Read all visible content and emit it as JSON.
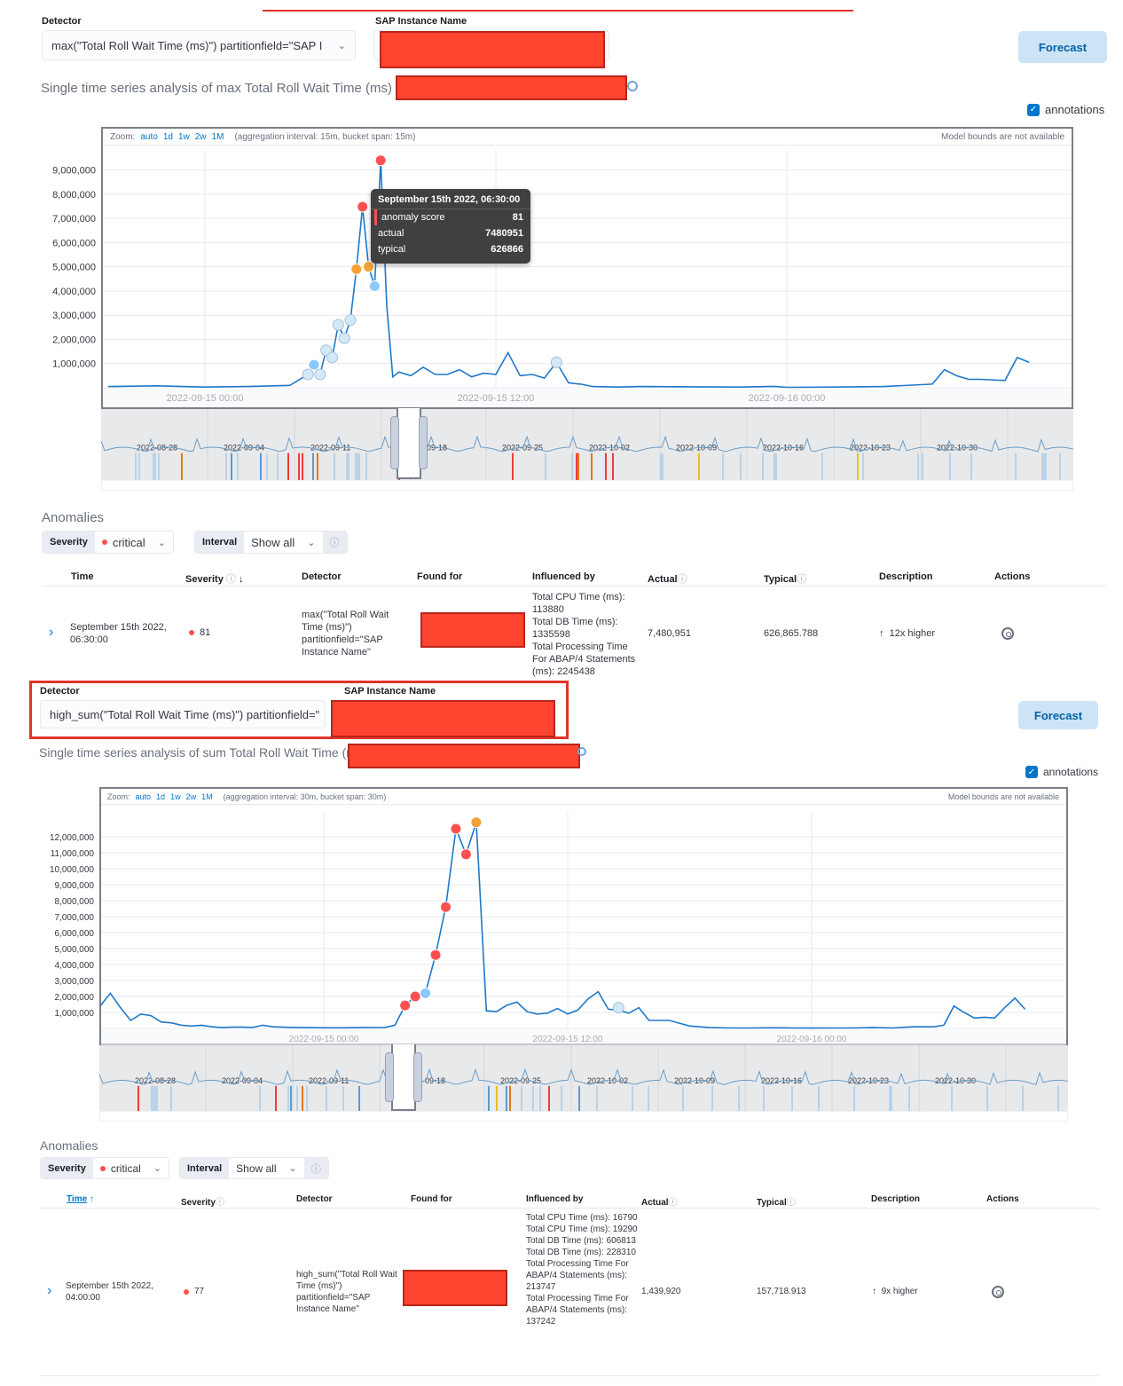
{
  "panel1": {
    "detector_label": "Detector",
    "detector_value": "max(\"Total Roll Wait Time (ms)\") partitionfield=\"SAP I",
    "instance_label": "SAP Instance Name",
    "forecast_label": "Forecast",
    "title": "Single time series analysis of max Total Roll Wait Time (ms)",
    "annotations_label": "annotations",
    "annotations_checked": true,
    "zoom_prefix": "Zoom:",
    "zoom_options": [
      "auto",
      "1d",
      "1w",
      "2w",
      "1M"
    ],
    "aggregation_text": "(aggregation interval: 15m, bucket span: 15m)",
    "model_bounds_text": "Model bounds are not available",
    "tooltip": {
      "title": "September 15th 2022, 06:30:00",
      "rows": [
        {
          "label": "anomaly score",
          "value": "81"
        },
        {
          "label": "actual",
          "value": "7480951"
        },
        {
          "label": "typical",
          "value": "626866"
        }
      ]
    },
    "context_labels": [
      "2022-08-28",
      "2022-09-04",
      "2022-09-11",
      "22-09-18",
      "2022-09-25",
      "2022-10-02",
      "2022-10-09",
      "2022-10-16",
      "2022-10-23",
      "2022-10-30"
    ],
    "anomalies": {
      "heading": "Anomalies",
      "severity_label": "Severity",
      "severity_value": "critical",
      "interval_label": "Interval",
      "interval_value": "Show all",
      "columns": [
        "Time",
        "Severity",
        "Detector",
        "Found for",
        "Influenced by",
        "Actual",
        "Typical",
        "Description",
        "Actions"
      ],
      "row": {
        "time": "September 15th 2022, 06:30:00",
        "severity": "81",
        "detector": "max(\"Total Roll Wait Time (ms)\") partitionfield=\"SAP Instance Name\"",
        "influenced_by": [
          "Total CPU Time (ms): 113880",
          "Total DB Time (ms): 1335598",
          "Total Processing Time For ABAP/4 Statements (ms): 2245438"
        ],
        "actual": "7,480,951",
        "typical": "626,865.788",
        "description": "12x higher"
      }
    }
  },
  "panel2": {
    "detector_label": "Detector",
    "detector_value": "high_sum(\"Total Roll Wait Time (ms)\") partitionfield=\"",
    "instance_label": "SAP Instance Name",
    "forecast_label": "Forecast",
    "title": "Single time series analysis of sum Total Roll Wait Time (m",
    "annotations_label": "annotations",
    "annotations_checked": true,
    "zoom_prefix": "Zoom:",
    "zoom_options": [
      "auto",
      "1d",
      "1w",
      "2w",
      "1M"
    ],
    "aggregation_text": "(aggregation interval: 30m, bucket span: 30m)",
    "model_bounds_text": "Model bounds are not available",
    "context_labels": [
      "2022-08-28",
      "2022-09-04",
      "2022-09-11",
      "22-09-18",
      "2022-09-25",
      "2022-10-02",
      "2022-10-09",
      "2022-10-16",
      "2022-10-23",
      "2022-10-30"
    ],
    "anomalies": {
      "heading": "Anomalies",
      "severity_label": "Severity",
      "severity_value": "critical",
      "interval_label": "Interval",
      "interval_value": "Show all",
      "columns": [
        "Time",
        "Severity",
        "Detector",
        "Found for",
        "Influenced by",
        "Actual",
        "Typical",
        "Description",
        "Actions"
      ],
      "row": {
        "time": "September 15th 2022, 04:00:00",
        "severity": "77",
        "detector": "high_sum(\"Total Roll Wait Time (ms)\") partitionfield=\"SAP Instance Name\"",
        "influenced_by": [
          "Total CPU Time (ms): 16790",
          "Total CPU Time (ms): 19290",
          "Total DB Time (ms): 606813",
          "Total DB Time (ms): 228310",
          "Total Processing Time For ABAP/4 Statements (ms): 213747",
          "Total Processing Time For ABAP/4 Statements (ms): 137242"
        ],
        "actual": "1,439,920",
        "typical": "157,718.913",
        "description": "9x higher"
      }
    }
  },
  "colors": {
    "line": "#1f78c8",
    "critical": "#fe5050",
    "major": "#f5a035",
    "minor": "#8bc8fb",
    "warning": "#d2e9f7",
    "accent": "#0077cc"
  },
  "chart_data": [
    {
      "type": "line",
      "title": "Single time series analysis of max Total Roll Wait Time (ms)",
      "x_ticks": [
        "2022-09-15 00:00",
        "2022-09-15 12:00",
        "2022-09-16 00:00"
      ],
      "y_ticks": [
        "1,000,000",
        "2,000,000",
        "3,000,000",
        "4,000,000",
        "5,000,000",
        "6,000,000",
        "7,000,000",
        "8,000,000",
        "9,000,000"
      ],
      "ylim": [
        0,
        9500000
      ],
      "x_hours": [
        -4,
        -2,
        0,
        2,
        3.5,
        4.25,
        4.5,
        4.75,
        5.0,
        5.25,
        5.5,
        5.75,
        6.0,
        6.25,
        6.5,
        6.75,
        7.0,
        7.25,
        7.5,
        7.75,
        8.0,
        8.5,
        9.0,
        9.5,
        10.0,
        10.5,
        11.0,
        11.5,
        12.0,
        12.5,
        13.0,
        13.5,
        14.0,
        14.5,
        15.0,
        15.5,
        16.0,
        17.0,
        18.0,
        20.0,
        22.0,
        23.5,
        24.0,
        26.0,
        28.0,
        30.0,
        30.5,
        31.0,
        31.5,
        32.0,
        33.0,
        33.5,
        34.0
      ],
      "values": [
        50000,
        80000,
        30000,
        60000,
        100000,
        550000,
        950000,
        550000,
        1550000,
        1250000,
        2600000,
        2050000,
        2800000,
        4900000,
        7480951,
        5000000,
        4200000,
        9400000,
        3400000,
        450000,
        650000,
        500000,
        850000,
        550000,
        550000,
        750000,
        450000,
        600000,
        550000,
        1450000,
        500000,
        550000,
        400000,
        1050000,
        200000,
        150000,
        50000,
        30000,
        50000,
        40000,
        30000,
        60000,
        20000,
        30000,
        50000,
        150000,
        750000,
        500000,
        350000,
        350000,
        300000,
        1250000,
        1050000
      ],
      "markers": [
        {
          "x_hour": 4.25,
          "value": 550000,
          "severity": "warning"
        },
        {
          "x_hour": 4.5,
          "value": 950000,
          "severity": "minor"
        },
        {
          "x_hour": 4.75,
          "value": 550000,
          "severity": "warning"
        },
        {
          "x_hour": 5.0,
          "value": 1550000,
          "severity": "warning"
        },
        {
          "x_hour": 5.25,
          "value": 1250000,
          "severity": "warning"
        },
        {
          "x_hour": 5.75,
          "value": 2050000,
          "severity": "warning"
        },
        {
          "x_hour": 5.5,
          "value": 2600000,
          "severity": "warning"
        },
        {
          "x_hour": 6.0,
          "value": 2800000,
          "severity": "warning"
        },
        {
          "x_hour": 6.25,
          "value": 4900000,
          "severity": "major"
        },
        {
          "x_hour": 6.5,
          "value": 7480951,
          "severity": "critical"
        },
        {
          "x_hour": 6.75,
          "value": 5000000,
          "severity": "major"
        },
        {
          "x_hour": 7.0,
          "value": 4200000,
          "severity": "minor"
        },
        {
          "x_hour": 7.25,
          "value": 9400000,
          "severity": "critical"
        },
        {
          "x_hour": 14.5,
          "value": 1050000,
          "severity": "warning"
        }
      ]
    },
    {
      "type": "line",
      "title": "Single time series analysis of sum Total Roll Wait Time (ms)",
      "x_ticks": [
        "2022-09-15 00:00",
        "2022-09-15 12:00",
        "2022-09-16 00:00"
      ],
      "y_ticks": [
        "1,000,000",
        "2,000,000",
        "3,000,000",
        "4,000,000",
        "5,000,000",
        "6,000,000",
        "7,000,000",
        "8,000,000",
        "9,000,000",
        "10,000,000",
        "11,000,000",
        "12,000,000"
      ],
      "ylim": [
        0,
        13000000
      ],
      "x_hours": [
        -11,
        -10.5,
        -10,
        -9.5,
        -9,
        -8.5,
        -8,
        -7.5,
        -7,
        -6.5,
        -6,
        -5.5,
        -5,
        -4.5,
        -4,
        -3.5,
        -3,
        -2.5,
        -2,
        -1.5,
        -1,
        0,
        1,
        2,
        3,
        3.5,
        4.0,
        4.5,
        5.0,
        5.5,
        6.0,
        6.5,
        7.0,
        7.5,
        8.0,
        8.5,
        9.0,
        9.5,
        10.0,
        10.5,
        11.0,
        11.5,
        12.0,
        12.5,
        13.0,
        13.5,
        14.0,
        14.5,
        15.0,
        15.5,
        16.0,
        17.0,
        18.0,
        19.0,
        20.0,
        21.0,
        22.0,
        23.0,
        24.0,
        25.0,
        26.0,
        27.0,
        28.0,
        29.0,
        30.0,
        30.5,
        31.0,
        31.5,
        32.0,
        32.5,
        33.0,
        33.5,
        34.0,
        34.5
      ],
      "values": [
        1400000,
        2200000,
        1300000,
        500000,
        900000,
        800000,
        400000,
        350000,
        200000,
        150000,
        200000,
        100000,
        50000,
        80000,
        80000,
        60000,
        200000,
        100000,
        80000,
        60000,
        50000,
        40000,
        40000,
        50000,
        60000,
        200000,
        1439920,
        2000000,
        2200000,
        4600000,
        7600000,
        12500000,
        10900000,
        12900000,
        1100000,
        1050000,
        1450000,
        1650000,
        1050000,
        900000,
        950000,
        1250000,
        900000,
        1150000,
        1850000,
        2300000,
        1200000,
        1150000,
        950000,
        1300000,
        500000,
        500000,
        150000,
        50000,
        30000,
        30000,
        40000,
        30000,
        20000,
        30000,
        30000,
        50000,
        30000,
        100000,
        100000,
        200000,
        1400000,
        1000000,
        650000,
        700000,
        650000,
        1300000,
        1900000,
        1200000
      ],
      "markers": [
        {
          "x_hour": 4.0,
          "value": 1439920,
          "severity": "critical"
        },
        {
          "x_hour": 4.5,
          "value": 2000000,
          "severity": "critical"
        },
        {
          "x_hour": 5.0,
          "value": 2200000,
          "severity": "minor"
        },
        {
          "x_hour": 5.5,
          "value": 4600000,
          "severity": "critical"
        },
        {
          "x_hour": 6.0,
          "value": 7600000,
          "severity": "critical"
        },
        {
          "x_hour": 6.5,
          "value": 12500000,
          "severity": "critical"
        },
        {
          "x_hour": 7.0,
          "value": 10900000,
          "severity": "critical"
        },
        {
          "x_hour": 7.5,
          "value": 12900000,
          "severity": "major"
        },
        {
          "x_hour": 14.5,
          "value": 1300000,
          "severity": "warning"
        }
      ]
    }
  ]
}
